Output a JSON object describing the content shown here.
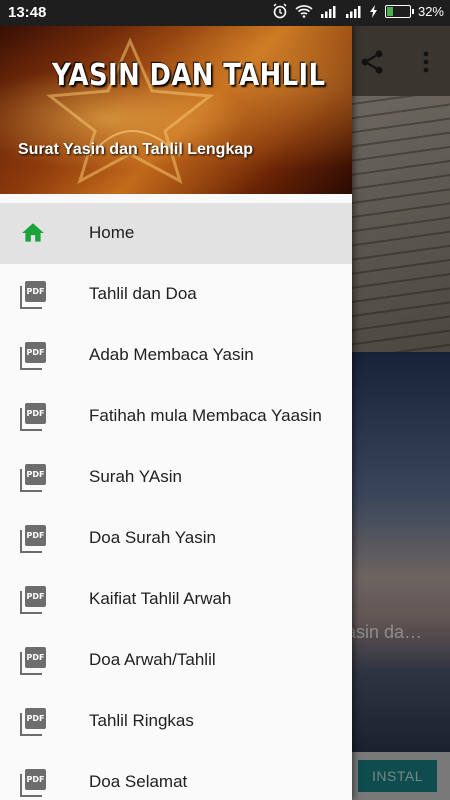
{
  "status_bar": {
    "time": "13:48",
    "battery_percent": "32%",
    "battery_level": 0.32,
    "icons": [
      "alarm-icon",
      "wifi-icon",
      "signal-icon",
      "signal-icon",
      "charging-icon"
    ]
  },
  "background_app": {
    "visible_title_fragment": "asin da…",
    "install_label": "INSTAL",
    "toolbar_icons": [
      "share-icon",
      "more-vert-icon"
    ]
  },
  "drawer": {
    "header": {
      "title": "YASIN DAN TAHLIL",
      "subtitle": "Surat Yasin dan Tahlil Lengkap"
    },
    "items": [
      {
        "label": "Home",
        "icon": "home-icon",
        "active": true
      },
      {
        "label": "Tahlil dan Doa",
        "icon": "pdf-icon",
        "active": false
      },
      {
        "label": "Adab Membaca Yasin",
        "icon": "pdf-icon",
        "active": false
      },
      {
        "label": "Fatihah mula Membaca Yaasin",
        "icon": "pdf-icon",
        "active": false
      },
      {
        "label": "Surah YAsin",
        "icon": "pdf-icon",
        "active": false
      },
      {
        "label": "Doa Surah Yasin",
        "icon": "pdf-icon",
        "active": false
      },
      {
        "label": "Kaifiat Tahlil Arwah",
        "icon": "pdf-icon",
        "active": false
      },
      {
        "label": "Doa Arwah/Tahlil",
        "icon": "pdf-icon",
        "active": false
      },
      {
        "label": "Tahlil Ringkas",
        "icon": "pdf-icon",
        "active": false
      },
      {
        "label": "Doa Selamat",
        "icon": "pdf-icon",
        "active": false
      }
    ]
  },
  "colors": {
    "home_icon": "#1aa33b",
    "pdf_icon": "#6d6d6d",
    "active_item_bg": "#e2e2e2",
    "install_button": "#1c8a8f"
  }
}
